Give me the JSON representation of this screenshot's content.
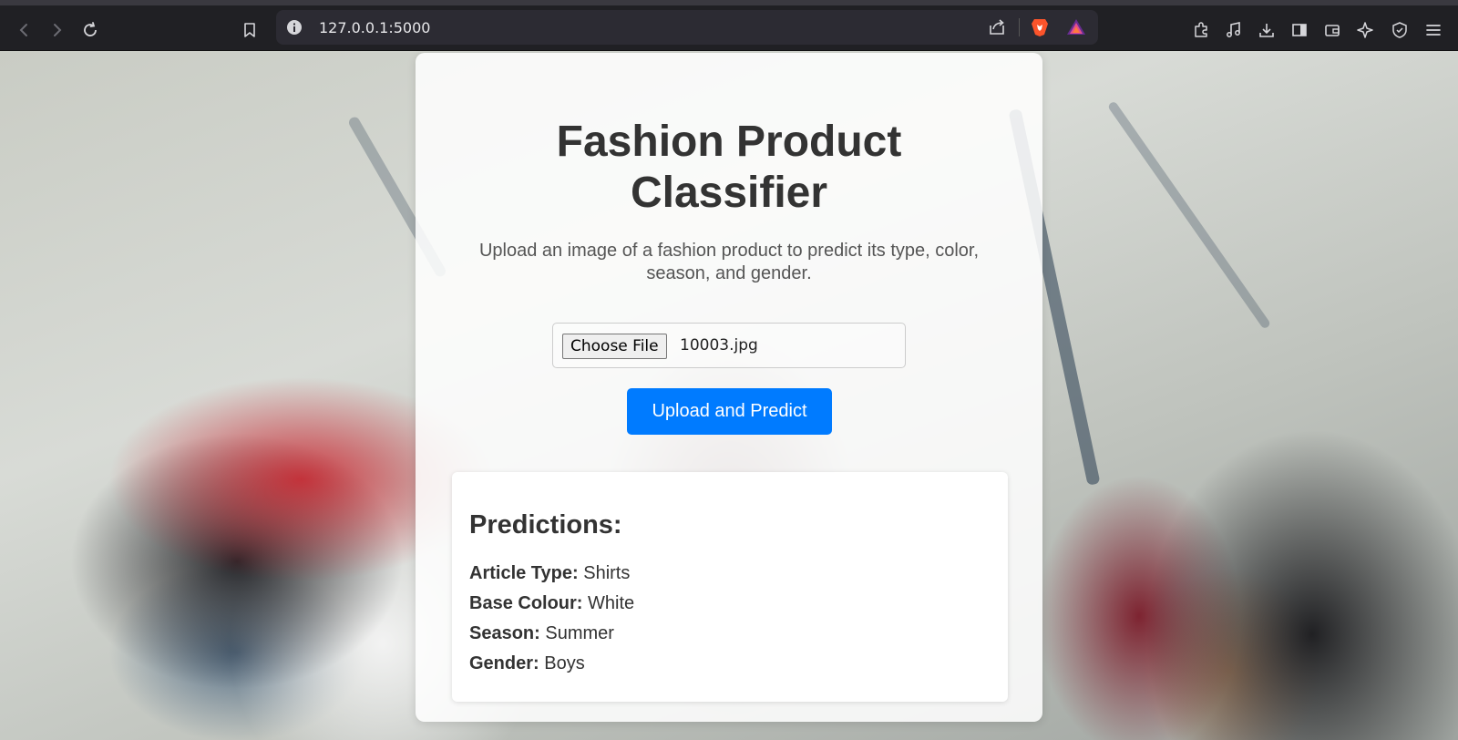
{
  "browser": {
    "url": "127.0.0.1:5000"
  },
  "main": {
    "title": "Fashion Product Classifier",
    "title_line1": "Fashion Product",
    "title_line2": "Classifier",
    "subtitle_line1": "Upload an image of a fashion product to predict its type, color,",
    "subtitle_line2": "season, and gender.",
    "file_button_label": "Choose File",
    "file_name": "10003.jpg",
    "submit_label": "Upload and Predict"
  },
  "predictions": {
    "heading": "Predictions:",
    "items": [
      {
        "label": "Article Type:",
        "value": "Shirts"
      },
      {
        "label": "Base Colour:",
        "value": "White"
      },
      {
        "label": "Season:",
        "value": "Summer"
      },
      {
        "label": "Gender:",
        "value": "Boys"
      }
    ]
  },
  "colors": {
    "accent": "#007bff",
    "heading": "#333333"
  }
}
